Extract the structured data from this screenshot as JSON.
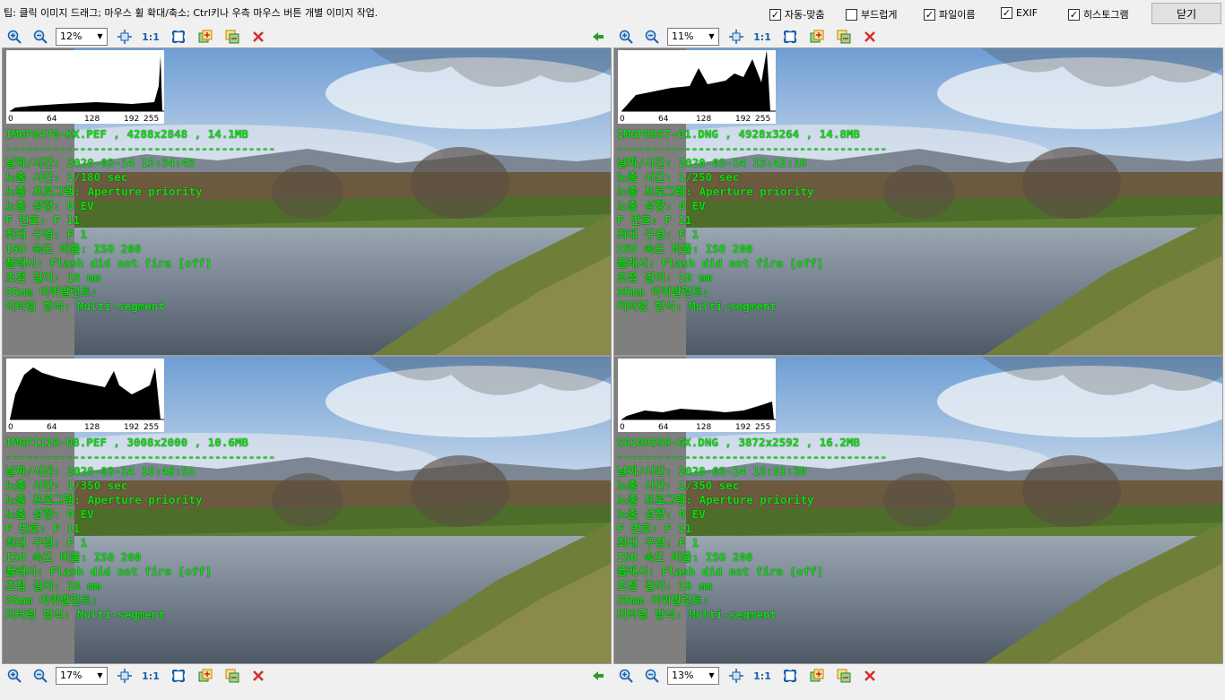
{
  "toolbar_top": {
    "tip": "팁: 클릭 이미지 드래그; 마우스 휠 확대/축소; Ctrl키나 우측 마우스 버튼 개별 이미지 작업.",
    "options": [
      {
        "label": "자동-맞춤",
        "checked": true
      },
      {
        "label": "부드럽게",
        "checked": false
      },
      {
        "label": "파일이름",
        "checked": true
      },
      {
        "label": "EXIF",
        "checked": true
      },
      {
        "label": "히스토그램",
        "checked": true
      }
    ],
    "close_label": "닫기"
  },
  "common": {
    "one_to_one": "1:1",
    "hist_ticks": [
      "0",
      "64",
      "128",
      "192",
      "255"
    ],
    "divider": "----------------------------------------",
    "labels": {
      "datetime": "날짜/시간: ",
      "exposure": "노출 시간: ",
      "program": "노출 프로그램: ",
      "bias": "노출 성향: ",
      "fnum": "F 번호: ",
      "maxap": "최대 구경: ",
      "iso": "ISO 속도 비율: ",
      "flash": "플래시: ",
      "focal": "초점 길이: ",
      "eq35": "35mm 이퀴발런트: ",
      "metering": "미터링 방식: "
    }
  },
  "panes": [
    {
      "zoom": "12%",
      "filename": "IMGP8470-KX.PEF , 4288x2848 , 14.1MB",
      "datetime": "2020-03-14 15:34:45",
      "exposure": "1/180 sec",
      "program": "Aperture priority",
      "bias": "0 EV",
      "fnum": "F 11",
      "maxap": "F 1",
      "iso": "ISO 200",
      "flash": "Flash did not fire [off]",
      "focal": "18 mm",
      "eq35": "",
      "metering": "Multi-segment",
      "back_arrow": true
    },
    {
      "zoom": "11%",
      "filename": "IMGP8957-01.DNG , 4928x3264 , 14.8MB",
      "datetime": "2020-03-14 15:42:16",
      "exposure": "1/250 sec",
      "program": "Aperture priority",
      "bias": "0 EV",
      "fnum": "F 11",
      "maxap": "F 1",
      "iso": "ISO 200",
      "flash": "Flash did not fire [off]",
      "focal": "18 mm",
      "eq35": "",
      "metering": "Multi-segment",
      "back_arrow": false
    },
    {
      "zoom": "17%",
      "filename": "IMGP1119-D8.PEF , 3008x2000 , 10.6MB",
      "datetime": "2020-03-14 15:46:51",
      "exposure": "1/350 sec",
      "program": "Aperture priority",
      "bias": "0 EV",
      "fnum": "F 11",
      "maxap": "F 1",
      "iso": "ISO 200",
      "flash": "Flash did not fire [off]",
      "focal": "18 mm",
      "eq35": "",
      "metering": "Multi-segment",
      "back_arrow": true
    },
    {
      "zoom": "13%",
      "filename": "SG109599-GX.DNG , 3872x2592 , 16.2MB",
      "datetime": "2020-03-14 15:51:30",
      "exposure": "1/350 sec",
      "program": "Aperture priority",
      "bias": "0 EV",
      "fnum": "F 11",
      "maxap": "F 1",
      "iso": "ISO 200",
      "flash": "Flash did not fire [off]",
      "focal": "18 mm",
      "eq35": "",
      "metering": "Multi-segment",
      "back_arrow": false
    }
  ]
}
